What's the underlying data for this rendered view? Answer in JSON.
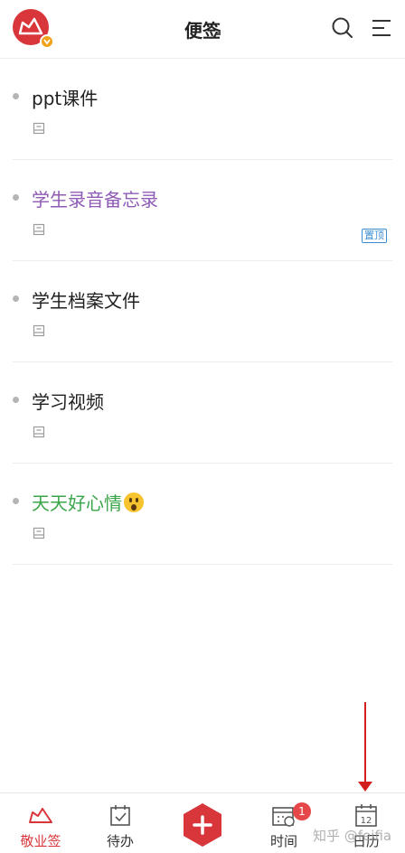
{
  "header": {
    "title": "便签",
    "logo_icon": "cloud-logo-icon",
    "search_icon": "search-icon",
    "menu_icon": "menu-icon"
  },
  "notes": [
    {
      "title": "ppt课件",
      "color": "#1f1f1f",
      "pinned": false
    },
    {
      "title": "学生录音备忘录",
      "color": "#8e5bb5",
      "pinned": true,
      "pin_label": "置顶"
    },
    {
      "title": "学生档案文件",
      "color": "#1f1f1f",
      "pinned": false
    },
    {
      "title": "学习视频",
      "color": "#1f1f1f",
      "pinned": false
    },
    {
      "title": "天天好心情",
      "color": "#3aa64a",
      "pinned": false,
      "emoji": "astonished-face"
    }
  ],
  "tabbar": {
    "tabs": [
      {
        "label": "敬业签",
        "icon": "cloud-icon",
        "active": true
      },
      {
        "label": "待办",
        "icon": "calendar-check-icon",
        "active": false
      },
      {
        "label": "",
        "icon": "add-icon",
        "active": false
      },
      {
        "label": "时间",
        "icon": "calendar-clock-icon",
        "active": false,
        "badge": "1"
      },
      {
        "label": "日历",
        "icon": "calendar-icon",
        "active": false,
        "day": "12"
      }
    ]
  },
  "watermark": "知乎 @feifia",
  "colors": {
    "accent": "#d8363b",
    "arrow": "#d21e1e",
    "pin": "#3b8ed4"
  }
}
